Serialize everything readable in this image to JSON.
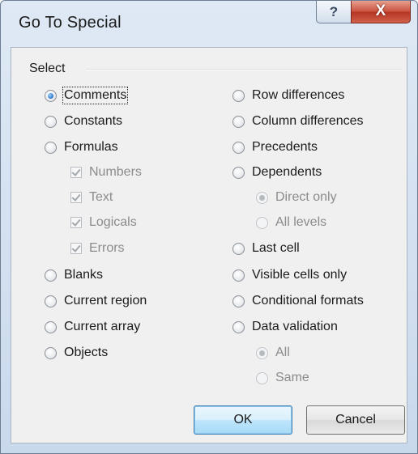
{
  "window": {
    "title": "Go To Special"
  },
  "titlebar": {
    "help_symbol": "?",
    "close_symbol": "X"
  },
  "group": {
    "label": "Select"
  },
  "left_options": [
    {
      "label": "Comments",
      "type": "radio",
      "checked": true,
      "enabled": true
    },
    {
      "label": "Constants",
      "type": "radio",
      "checked": false,
      "enabled": true
    },
    {
      "label": "Formulas",
      "type": "radio",
      "checked": false,
      "enabled": true
    },
    {
      "label": "Numbers",
      "type": "checkbox",
      "checked": true,
      "enabled": false
    },
    {
      "label": "Text",
      "type": "checkbox",
      "checked": true,
      "enabled": false
    },
    {
      "label": "Logicals",
      "type": "checkbox",
      "checked": true,
      "enabled": false
    },
    {
      "label": "Errors",
      "type": "checkbox",
      "checked": true,
      "enabled": false
    },
    {
      "label": "Blanks",
      "type": "radio",
      "checked": false,
      "enabled": true
    },
    {
      "label": "Current region",
      "type": "radio",
      "checked": false,
      "enabled": true
    },
    {
      "label": "Current array",
      "type": "radio",
      "checked": false,
      "enabled": true
    },
    {
      "label": "Objects",
      "type": "radio",
      "checked": false,
      "enabled": true
    }
  ],
  "right_options": [
    {
      "label": "Row differences",
      "type": "radio",
      "checked": false,
      "enabled": true
    },
    {
      "label": "Column differences",
      "type": "radio",
      "checked": false,
      "enabled": true
    },
    {
      "label": "Precedents",
      "type": "radio",
      "checked": false,
      "enabled": true
    },
    {
      "label": "Dependents",
      "type": "radio",
      "checked": false,
      "enabled": true
    },
    {
      "label": "Direct only",
      "type": "radio",
      "checked": true,
      "enabled": false
    },
    {
      "label": "All levels",
      "type": "radio",
      "checked": false,
      "enabled": false
    },
    {
      "label": "Last cell",
      "type": "radio",
      "checked": false,
      "enabled": true
    },
    {
      "label": "Visible cells only",
      "type": "radio",
      "checked": false,
      "enabled": true
    },
    {
      "label": "Conditional formats",
      "type": "radio",
      "checked": false,
      "enabled": true
    },
    {
      "label": "Data validation",
      "type": "radio",
      "checked": false,
      "enabled": true
    },
    {
      "label": "All",
      "type": "radio",
      "checked": true,
      "enabled": false
    },
    {
      "label": "Same",
      "type": "radio",
      "checked": false,
      "enabled": false
    }
  ],
  "buttons": {
    "ok": "OK",
    "cancel": "Cancel"
  }
}
